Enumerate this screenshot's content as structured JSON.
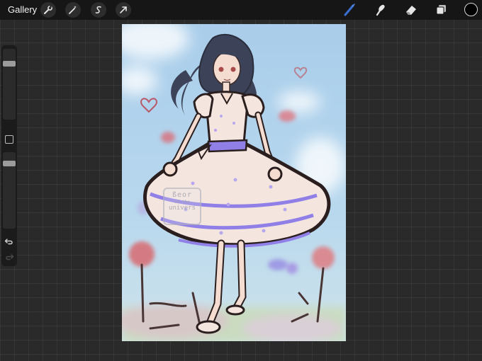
{
  "toolbar": {
    "gallery_label": "Gallery",
    "left_tools": [
      "wrench-icon",
      "magic-wand-icon",
      "selection-s-icon",
      "transform-arrow-icon"
    ],
    "right_tools": [
      "brush-icon",
      "smudge-icon",
      "eraser-icon",
      "layers-icon"
    ],
    "active_tool": "brush-icon",
    "brush_color": "#3a6fd1",
    "current_color": "#000000"
  },
  "sidebar": {
    "brush_size_level": 0.18,
    "opacity_level": 0.12,
    "undo_icon": "undo-icon",
    "redo_icon": "redo-icon"
  },
  "artwork": {
    "watermark": [
      "ßeor",
      "of the",
      "univers"
    ],
    "sky_color": "#a6cde8",
    "dress_color": "#f4e6df",
    "ribbon_color": "#8f7fe6",
    "hair_color": "#3c4258"
  }
}
